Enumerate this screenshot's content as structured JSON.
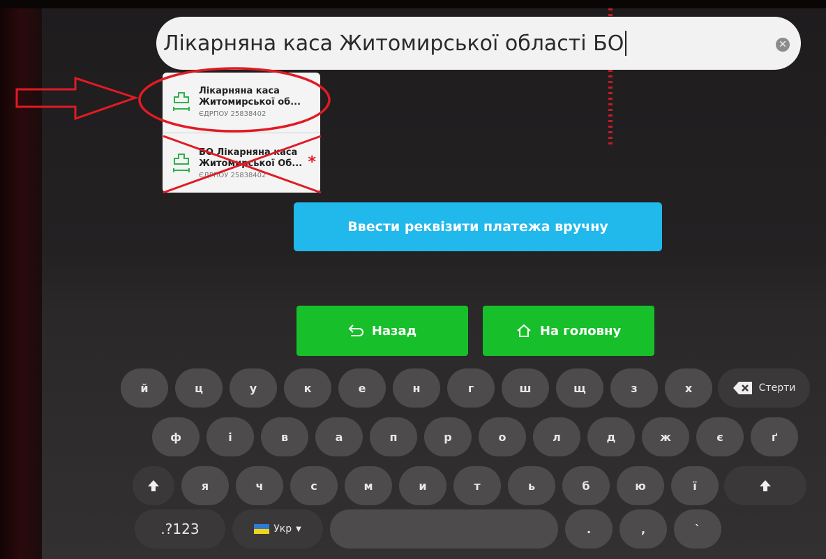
{
  "search": {
    "value": "Лікарняна каса Житомирської області БО",
    "clear_icon": "clear-x-icon"
  },
  "suggestions": [
    {
      "name_line1": "Лікарняна каса",
      "name_line2": "Житомирської об...",
      "code": "ЄДРПОУ 25838402",
      "icon": "medical-cross-icon"
    },
    {
      "name_line1": "БО Лікарняна каса",
      "name_line2": "Житомирської Об...",
      "code": "ЄДРПОУ 25838402",
      "icon": "medical-cross-icon",
      "marker": "*"
    }
  ],
  "manual_button": {
    "label": "Ввести реквізити платежа вручну"
  },
  "nav": {
    "back_label": "Назад",
    "home_label": "На головну"
  },
  "keyboard": {
    "row1": [
      "й",
      "ц",
      "у",
      "к",
      "е",
      "н",
      "г",
      "ш",
      "щ",
      "з",
      "х"
    ],
    "row2": [
      "ф",
      "і",
      "в",
      "а",
      "п",
      "р",
      "о",
      "л",
      "д",
      "ж",
      "є",
      "ґ"
    ],
    "row3": [
      "я",
      "ч",
      "с",
      "м",
      "и",
      "т",
      "ь",
      "б",
      "ю",
      "ї"
    ],
    "delete_label": "Стерти",
    "symbols_label": ".?123",
    "lang_label": "Укр",
    "punct": [
      ".",
      ",",
      "`"
    ]
  },
  "colors": {
    "accent_blue": "#21b8ec",
    "accent_green": "#17c02a",
    "annotation_red": "#e01b24"
  }
}
